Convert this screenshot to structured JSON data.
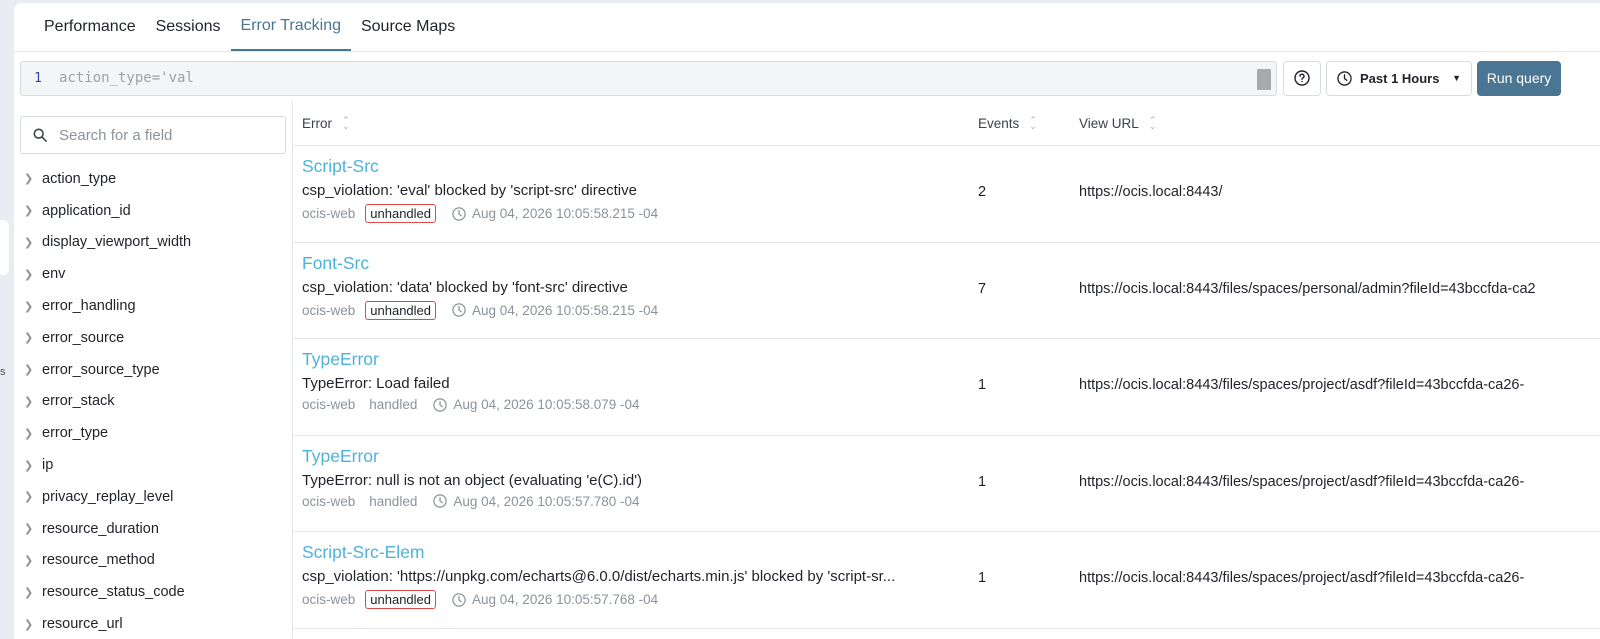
{
  "tabs": [
    {
      "label": "Performance"
    },
    {
      "label": "Sessions"
    },
    {
      "label": "Error Tracking"
    },
    {
      "label": "Source Maps"
    }
  ],
  "active_tab": "Error Tracking",
  "query": {
    "line_number": "1",
    "text": "action_type='val"
  },
  "time_range": {
    "label": "Past 1 Hours"
  },
  "run_button": "Run query",
  "field_search": {
    "placeholder": "Search for a field"
  },
  "fields": [
    "action_type",
    "application_id",
    "display_viewport_width",
    "env",
    "error_handling",
    "error_source",
    "error_source_type",
    "error_stack",
    "error_type",
    "ip",
    "privacy_replay_level",
    "resource_duration",
    "resource_method",
    "resource_status_code",
    "resource_url"
  ],
  "table": {
    "headers": {
      "error": "Error",
      "events": "Events",
      "url": "View URL"
    },
    "rows": [
      {
        "title": "Script-Src",
        "message": "csp_violation: 'eval' blocked by 'script-src' directive",
        "service": "ocis-web",
        "handling": "unhandled",
        "timestamp": "Aug 04, 2026 10:05:58.215 -04",
        "events": "2",
        "url": "https://ocis.local:8443/"
      },
      {
        "title": "Font-Src",
        "message": "csp_violation: 'data' blocked by 'font-src' directive",
        "service": "ocis-web",
        "handling": "unhandled",
        "timestamp": "Aug 04, 2026 10:05:58.215 -04",
        "events": "7",
        "url": "https://ocis.local:8443/files/spaces/personal/admin?fileId=43bccfda-ca2"
      },
      {
        "title": "TypeError",
        "message": "TypeError: Load failed",
        "service": "ocis-web",
        "handling": "handled",
        "timestamp": "Aug 04, 2026 10:05:58.079 -04",
        "events": "1",
        "url": "https://ocis.local:8443/files/spaces/project/asdf?fileId=43bccfda-ca26-"
      },
      {
        "title": "TypeError",
        "message": "TypeError: null is not an object (evaluating 'e(C).id')",
        "service": "ocis-web",
        "handling": "handled",
        "timestamp": "Aug 04, 2026 10:05:57.780 -04",
        "events": "1",
        "url": "https://ocis.local:8443/files/spaces/project/asdf?fileId=43bccfda-ca26-"
      },
      {
        "title": "Script-Src-Elem",
        "message": "csp_violation: 'https://unpkg.com/echarts@6.0.0/dist/echarts.min.js' blocked by 'script-sr...",
        "service": "ocis-web",
        "handling": "unhandled",
        "timestamp": "Aug 04, 2026 10:05:57.768 -04",
        "events": "1",
        "url": "https://ocis.local:8443/files/spaces/project/asdf?fileId=43bccfda-ca26-"
      }
    ]
  },
  "colors": {
    "accent": "#4a7694",
    "error_title": "#4fb3d9",
    "unhandled_border": "#e0494a"
  },
  "icons": {
    "search": "search-icon",
    "help": "help-circle-icon",
    "clock": "clock-icon",
    "caret": "caret-down-icon",
    "chevron": "chevron-right-icon",
    "sort": "sort-icon"
  }
}
